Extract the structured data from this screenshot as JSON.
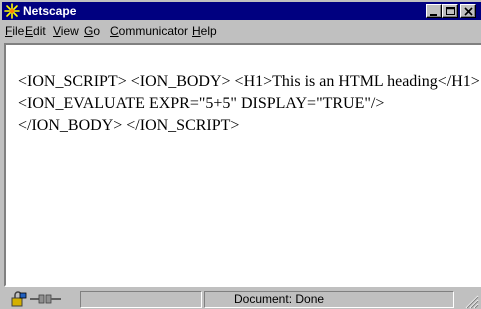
{
  "window": {
    "title": "Netscape",
    "app_icon": "netscape-star-icon",
    "title_bar_color": "#000080",
    "face_color": "#c0c0c0",
    "controls": [
      "minimize-icon",
      "maximize-icon",
      "close-icon"
    ]
  },
  "menubar": {
    "items": [
      {
        "mnemonic": "F",
        "rest": "ile"
      },
      {
        "mnemonic": "E",
        "rest": "dit"
      },
      {
        "mnemonic": "V",
        "rest": "iew"
      },
      {
        "mnemonic": "G",
        "rest": "o"
      },
      {
        "mnemonic": "C",
        "rest": "ommunicator"
      },
      {
        "mnemonic": "H",
        "rest": "elp"
      }
    ]
  },
  "content": {
    "text": "<ION_SCRIPT> <ION_BODY> <H1>This is an HTML heading</H1> <ION_EVALUATE EXPR=\"5+5\" DISPLAY=\"TRUE\"/> </ION_BODY> </ION_SCRIPT>"
  },
  "statusbar": {
    "text": "Document: Done",
    "icons": [
      "security-lock-icon",
      "connection-plug-icon"
    ]
  }
}
